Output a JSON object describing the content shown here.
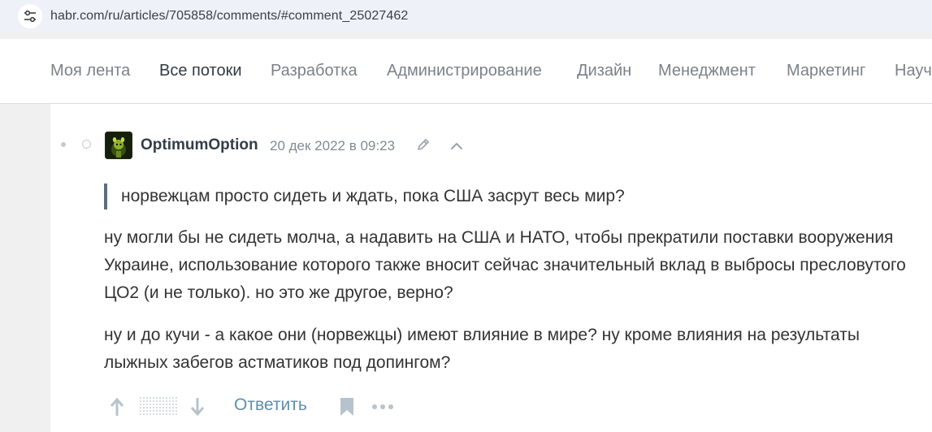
{
  "browser": {
    "url": "habr.com/ru/articles/705858/comments/#comment_25027462"
  },
  "nav": {
    "items": [
      {
        "label": "Моя лента",
        "active": false
      },
      {
        "label": "Все потоки",
        "active": true
      },
      {
        "label": "Разработка",
        "active": false
      },
      {
        "label": "Администрирование",
        "active": false
      },
      {
        "label": "Дизайн",
        "active": false
      },
      {
        "label": "Менеджмент",
        "active": false
      },
      {
        "label": "Маркетинг",
        "active": false
      },
      {
        "label": "Научпоп",
        "active": false
      }
    ]
  },
  "comment": {
    "author": "OptimumOption",
    "timestamp": "20 дек 2022 в 09:23",
    "quote": "норвежцам просто сидеть и ждать, пока США засрут весь мир?",
    "paragraphs": [
      "ну могли бы не сидеть молча, а надавить на США и НАТО, чтобы прекратили поставки вооружения Украине, использование которого также вносит сейчас значительный вклад в выбросы пресловутого ЦО2 (и не только). но это же другое, верно?",
      "ну и до кучи - а какое они (норвежцы) имеют влияние в мире? ну кроме влияния на результаты лыжных забегов астматиков под допингом?"
    ],
    "actions": {
      "reply_label": "Ответить"
    }
  },
  "colors": {
    "link": "#5e8eac",
    "quote_bar": "#5e6d7e",
    "nav_inactive": "#7b8289",
    "nav_active": "#303b44"
  },
  "icons": [
    "settings-sliders-icon",
    "pencil-icon",
    "chevron-up-icon",
    "arrow-up-icon",
    "arrow-down-icon",
    "bookmark-icon",
    "more-dots-icon"
  ]
}
